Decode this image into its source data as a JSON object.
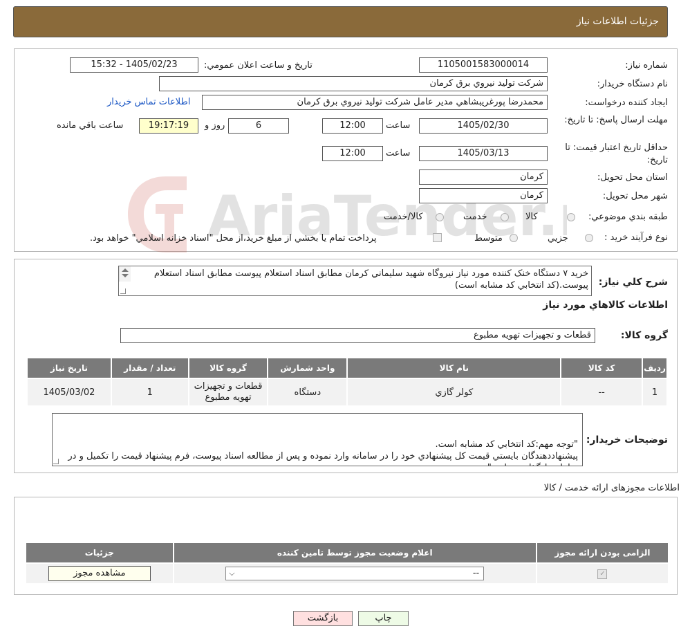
{
  "header": {
    "title": "جزئيات اطلاعات نياز"
  },
  "form": {
    "need_number_label": "شماره نياز:",
    "need_number": "1105001583000014",
    "announce_label": "تاريخ و ساعت اعلان عمومي:",
    "announce_value": "1405/02/23 - 15:32",
    "buyer_org_label": "نام دستگاه خريدار:",
    "buyer_org": "شركت توليد نيروي برق كرمان",
    "creator_label": "ايجاد كننده درخواست:",
    "creator": "محمدرضا پورغريبشاهي مدير عامل شركت توليد نيروي برق كرمان",
    "contact_link": "اطلاعات تماس خريدار",
    "reply_deadline_label": "مهلت ارسال پاسخ: تا تاريخ:",
    "reply_date": "1405/02/30",
    "time_label": "ساعت",
    "reply_time": "12:00",
    "days": "6",
    "days_label": "روز و",
    "remaining": "19:17:19",
    "remaining_label": "ساعت باقي مانده",
    "price_validity_label": "حداقل تاريخ اعتبار قيمت: تا تاريخ:",
    "price_date": "1405/03/13",
    "price_time": "12:00",
    "province_label": "استان محل تحويل:",
    "province": "كرمان",
    "city_label": "شهر محل تحويل:",
    "city": "كرمان",
    "category_label": "طبقه بندي موضوعي:",
    "category_options": [
      "كالا",
      "خدمت",
      "كالا/خدمت"
    ],
    "process_label": "نوع فرآيند خريد :",
    "process_options": [
      "جزيي",
      "متوسط"
    ],
    "process_note": "پرداخت تمام يا بخشي از مبلغ خريد،از محل \"اسناد خزانه اسلامي\" خواهد بود."
  },
  "description": {
    "label": "شرح كلي نياز:",
    "text": "خريد ۷ دستگاه خنک کننده مورد نياز نيروگاه شهيد سليماني کرمان مطابق اسناد استعلام پيوست مطابق اسناد استعلام پيوست.(کد انتخابي کد مشابه است)"
  },
  "goods": {
    "section_title": "اطلاعات كالاهاي مورد نياز",
    "group_label": "گروه كالا:",
    "group_value": "قطعات و تجهيزات تهويه مطبوع",
    "columns": [
      "رديف",
      "كد كالا",
      "نام كالا",
      "واحد شمارش",
      "گروه كالا",
      "تعداد / مقدار",
      "تاريخ نياز"
    ],
    "rows": [
      [
        "1",
        "--",
        "كولر گازي",
        "دستگاه",
        "قطعات و تجهيزات تهويه مطبوع",
        "1",
        "1405/03/02"
      ]
    ]
  },
  "buyer_notes": {
    "label": "توضيحات خريدار:",
    "text": "\"توجه مهم:کد انتخابي کد مشابه است.\nپيشنهاددهندگان بايستي قيمت کل پيشنهادي خود را در سامانه وارد نموده و پس از مطالعه اسناد پيوست، فرم پيشنهاد قيمت را تكميل و در سامانه بارگذاري نمايند.\""
  },
  "permits": {
    "section_title": "اطلاعات مجوزهای ارائه خدمت / کالا",
    "columns": [
      "الزامی بودن ارائه مجوز",
      "اعلام وضعيت مجوز توسط تامين کننده",
      "جزئيات"
    ],
    "select_value": "--",
    "view_button": "مشاهده مجوز"
  },
  "buttons": {
    "print": "چاپ",
    "back": "بازگشت"
  },
  "watermark": {
    "text": "AriaTender.neT"
  }
}
